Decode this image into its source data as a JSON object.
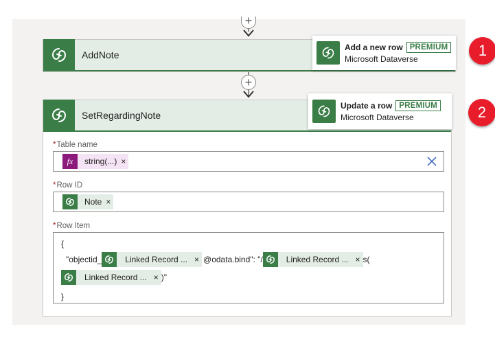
{
  "steps": [
    {
      "title": "AddNote",
      "tooltip": {
        "action": "Add a new row",
        "badge": "PREMIUM",
        "connector": "Microsoft Dataverse"
      },
      "callout": "1"
    },
    {
      "title": "SetRegardingNote",
      "tooltip": {
        "action": "Update a row",
        "badge": "PREMIUM",
        "connector": "Microsoft Dataverse"
      },
      "callout": "2",
      "fields": {
        "table_name": {
          "label": "Table name",
          "required_mark": "*",
          "token": "string(...)"
        },
        "row_id": {
          "label": "Row ID",
          "required_mark": "*",
          "token": "Note"
        },
        "row_item": {
          "label": "Row Item",
          "required_mark": "*",
          "line1": "{",
          "line2_prefix": "\"objectid_",
          "token_a": "Linked Record ...",
          "line2_middle": "@odata.bind\": \"/",
          "token_b": "Linked Record ...",
          "line2_suffix": "s(",
          "token_c": "Linked Record ...",
          "line3_suffix": ")\"",
          "line4": "}"
        }
      }
    }
  ],
  "token_remove_glyph": "×",
  "expression_icon_text": "fx",
  "colors": {
    "dataverse_green": "#3a7d47",
    "header_bg": "#e3ede6",
    "expression_purple": "#8b1a7c",
    "callout_red": "#e81c2a"
  },
  "icons": [
    "add-icon",
    "arrow-down-icon",
    "dataverse-icon",
    "expression-icon",
    "close-icon"
  ]
}
